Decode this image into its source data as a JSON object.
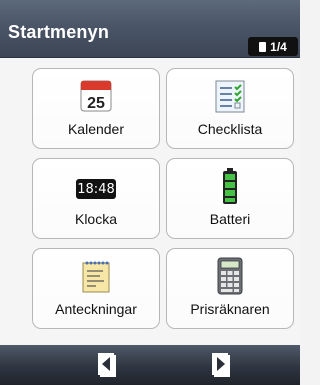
{
  "header": {
    "title": "Startmenyn",
    "page_indicator": "1/4"
  },
  "tiles": [
    {
      "label": "Kalender",
      "icon": "calendar-icon",
      "icon_text": "25"
    },
    {
      "label": "Checklista",
      "icon": "checklist-icon"
    },
    {
      "label": "Klocka",
      "icon": "clock-icon",
      "icon_text": "18:48"
    },
    {
      "label": "Batteri",
      "icon": "battery-icon"
    },
    {
      "label": "Anteckningar",
      "icon": "notes-icon"
    },
    {
      "label": "Prisräknaren",
      "icon": "price-calculator-icon"
    }
  ],
  "footer": {
    "prev_icon": "page-back-icon",
    "next_icon": "page-forward-icon"
  },
  "colors": {
    "header": "#4a5567",
    "footer": "#2f3641",
    "tile_border": "#b7b7b7",
    "calendar_red": "#d93a2b",
    "battery_green": "#2ea52e"
  }
}
